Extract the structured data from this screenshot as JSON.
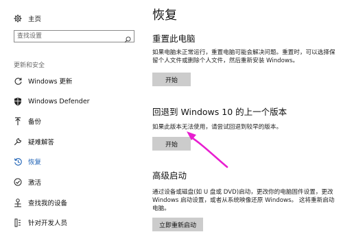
{
  "sidebar": {
    "home_label": "主页",
    "search_placeholder": "查找设置",
    "section_label": "更新和安全",
    "items": [
      {
        "label": "Windows 更新",
        "icon": "refresh-icon"
      },
      {
        "label": "Windows Defender",
        "icon": "shield-icon"
      },
      {
        "label": "备份",
        "icon": "backup-arrow-icon"
      },
      {
        "label": "疑难解答",
        "icon": "wrench-icon"
      },
      {
        "label": "恢复",
        "icon": "history-icon"
      },
      {
        "label": "激活",
        "icon": "check-circle-icon"
      },
      {
        "label": "查找我的设备",
        "icon": "person-locate-icon"
      },
      {
        "label": "针对开发人员",
        "icon": "developer-icon"
      }
    ]
  },
  "main": {
    "title": "恢复",
    "reset": {
      "title": "重置此电脑",
      "description": "如果电脑未正常运行，重置电脑可能会解决问题。重置时，可以选择保留个人文件或删除个人文件，然后重新安装 Windows。",
      "button": "开始"
    },
    "rollback": {
      "title": "回退到 Windows 10 的上一个版本",
      "description": "如果此版本无法使用，请尝试回退到较早的版本。",
      "button": "开始"
    },
    "advanced": {
      "title": "高级启动",
      "description": "通过设备或磁盘(如 U 盘或 DVD)启动，更改你的电脑固件设置，更改 Windows 启动设置，或者从系统映像还原 Windows。 这将重新启动电脑。",
      "button": "立即重新启动"
    }
  },
  "colors": {
    "accent": "#1a5fb4",
    "button_bg": "#cccccc",
    "annotation_arrow": "#e81ed0"
  }
}
